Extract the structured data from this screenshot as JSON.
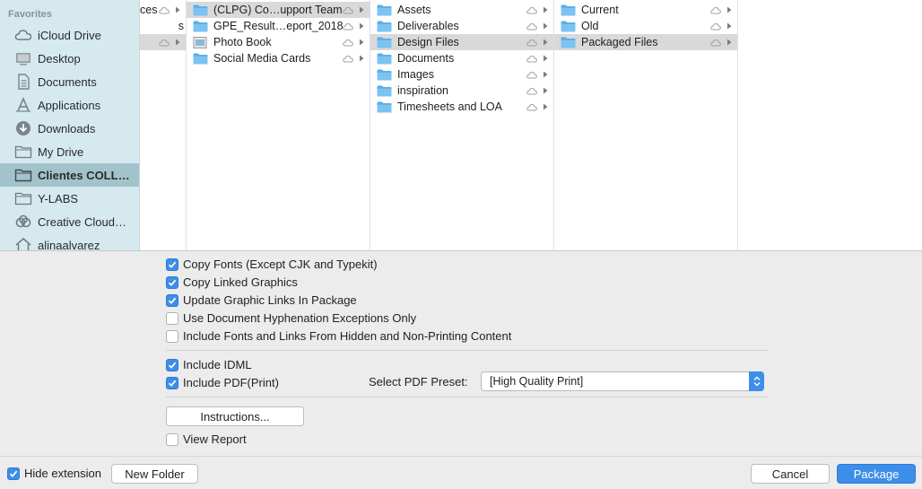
{
  "sidebar": {
    "heading": "Favorites",
    "items": [
      {
        "label": "iCloud Drive",
        "icon": "cloud-icon"
      },
      {
        "label": "Desktop",
        "icon": "desktop-icon"
      },
      {
        "label": "Documents",
        "icon": "document-icon"
      },
      {
        "label": "Applications",
        "icon": "applications-icon"
      },
      {
        "label": "Downloads",
        "icon": "downloads-icon"
      },
      {
        "label": "My Drive",
        "icon": "folder-icon"
      },
      {
        "label": "Clientes COLL…",
        "icon": "folder-icon",
        "selected": true
      },
      {
        "label": "Y-LABS",
        "icon": "folder-icon"
      },
      {
        "label": "Creative Cloud…",
        "icon": "creative-cloud-icon"
      },
      {
        "label": "alinaalvarez",
        "icon": "home-icon"
      }
    ]
  },
  "columns": {
    "col0": [
      "ces",
      "s",
      ""
    ],
    "col1": [
      "(CLPG) Co…upport Team",
      "GPE_Result…eport_2018",
      "Photo Book",
      "Social Media Cards"
    ],
    "col2": [
      "Assets",
      "Deliverables",
      "Design Files",
      "Documents",
      "Images",
      "inspiration",
      "Timesheets and LOA"
    ],
    "col3": [
      "Current",
      "Old",
      "Packaged Files"
    ]
  },
  "options": {
    "copy_fonts": {
      "label": "Copy Fonts (Except CJK and Typekit)",
      "checked": true
    },
    "copy_linked": {
      "label": "Copy Linked Graphics",
      "checked": true
    },
    "update_links": {
      "label": "Update Graphic Links In Package",
      "checked": true
    },
    "hyphenation": {
      "label": "Use Document Hyphenation Exceptions Only",
      "checked": false
    },
    "include_hidden": {
      "label": "Include Fonts and Links From Hidden and Non-Printing Content",
      "checked": false
    },
    "include_idml": {
      "label": "Include IDML",
      "checked": true
    },
    "include_pdf": {
      "label": "Include PDF(Print)",
      "checked": true
    },
    "view_report": {
      "label": "View Report",
      "checked": false
    }
  },
  "pdf_preset": {
    "label": "Select PDF Preset:",
    "value": "[High Quality Print]"
  },
  "buttons": {
    "instructions": "Instructions...",
    "new_folder": "New Folder",
    "cancel": "Cancel",
    "package": "Package"
  },
  "hide_extension": {
    "label": "Hide extension",
    "checked": true
  },
  "colors": {
    "accent": "#3d8ee8",
    "sidebar_bg": "#d5e9ef",
    "sidebar_selected": "#a3c3cc"
  }
}
